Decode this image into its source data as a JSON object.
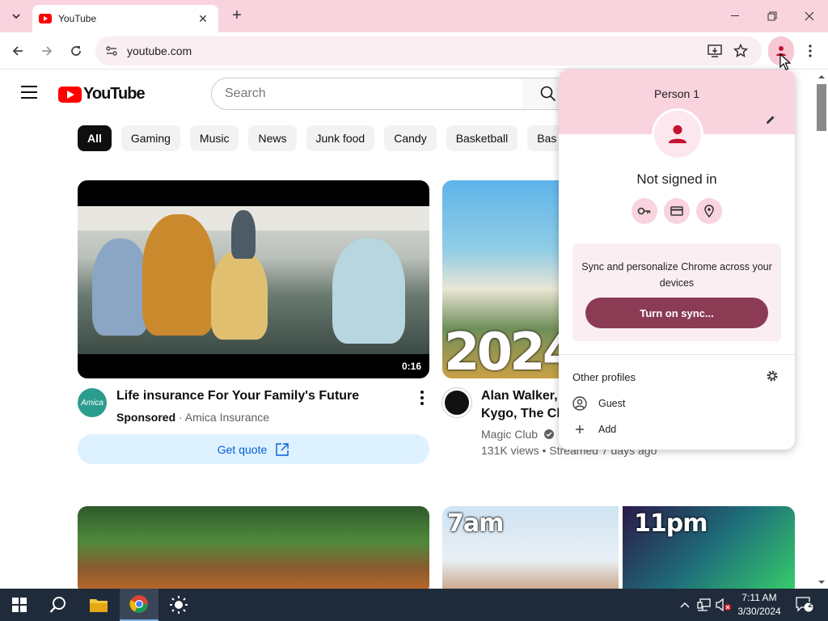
{
  "browser": {
    "tab_title": "YouTube",
    "url": "youtube.com",
    "new_tab": "+",
    "tab_close": "✕"
  },
  "youtube": {
    "logo_text": "YouTube",
    "search_placeholder": "Search",
    "chips": [
      "All",
      "Gaming",
      "Music",
      "News",
      "Junk food",
      "Candy",
      "Basketball",
      "Bas"
    ],
    "videos": [
      {
        "title": "Life insurance For Your Family's Future",
        "sponsored_label": "Sponsored",
        "channel": "· Amica Insurance",
        "channel_avatar_text": "Amica",
        "duration": "0:16",
        "cta": "Get quote"
      },
      {
        "title_line1": "Alan Walker, D",
        "title_line2": "Kygo, The Cha",
        "channel": "Magic Club",
        "stats": "131K views • Streamed 7 days ago",
        "thumb_text": "2024"
      }
    ],
    "thumb_labels": [
      "7am",
      "11pm"
    ]
  },
  "profile_menu": {
    "name": "Person 1",
    "status": "Not signed in",
    "sync_text": "Sync and personalize Chrome across your devices",
    "sync_button": "Turn on sync...",
    "other_profiles_title": "Other profiles",
    "guest": "Guest",
    "add": "Add",
    "icons": [
      "key-icon",
      "card-icon",
      "location-pin-icon"
    ]
  },
  "taskbar": {
    "time": "7:11 AM",
    "date": "3/30/2024",
    "notification_count": "2"
  },
  "colors": {
    "chrome_pink": "#f9d3dd",
    "sync_button": "#8c3b55",
    "youtube_red": "#ff0000",
    "cta_blue": "#065fd4"
  }
}
